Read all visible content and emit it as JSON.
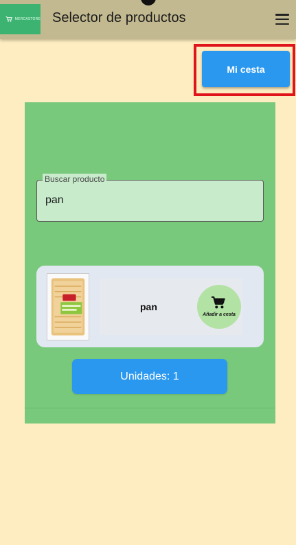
{
  "header": {
    "logo_text": "MERCASTORE",
    "title": "Selector de productos",
    "menu_icon": "hamburger-menu-icon"
  },
  "cart_button": {
    "label": "Mi cesta"
  },
  "search": {
    "label": "Buscar producto",
    "value": "pan"
  },
  "product": {
    "name": "pan",
    "add_to_cart_label": "Añadir a cesta",
    "add_to_cart_icon": "shopping-cart-icon"
  },
  "units": {
    "label": "Unidades: 1"
  },
  "colors": {
    "background": "#fdedc0",
    "appbar": "#c3b990",
    "panel": "#78c97b",
    "primary_button": "#2b98f0",
    "highlight_frame": "#e0141b"
  }
}
